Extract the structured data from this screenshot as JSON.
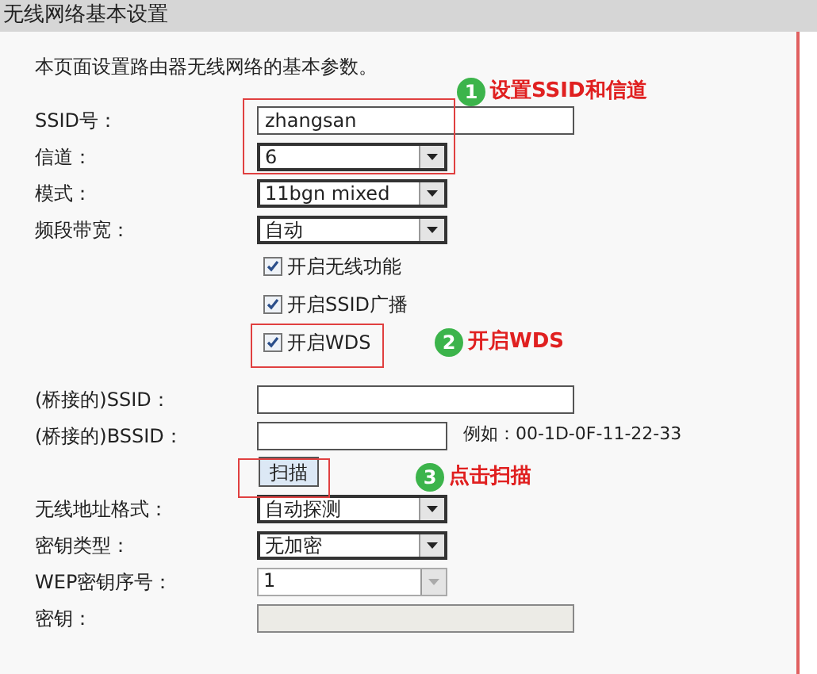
{
  "header": {
    "title": "无线网络基本设置"
  },
  "description": "本页面设置路由器无线网络的基本参数。",
  "groups": [
    {
      "fields": [
        {
          "kind": "text",
          "label": "SSID号：",
          "value": "zhangsan",
          "disabled": false
        },
        {
          "kind": "select",
          "label": "信道：",
          "value": "6",
          "disabled": false
        },
        {
          "kind": "select",
          "label": "模式：",
          "value": "11bgn mixed",
          "disabled": false
        },
        {
          "kind": "select",
          "label": "频段带宽：",
          "value": "自动",
          "disabled": false
        },
        {
          "kind": "checkbox",
          "text": "开启无线功能",
          "checked": true
        },
        {
          "kind": "checkbox",
          "text": "开启SSID广播",
          "checked": true
        },
        {
          "kind": "checkbox",
          "text": "开启WDS",
          "checked": true
        }
      ]
    },
    {
      "fields": [
        {
          "kind": "text",
          "label": "(桥接的)SSID：",
          "disabled": false
        },
        {
          "kind": "mac",
          "label": "(桥接的)BSSID：",
          "example": "例如：00-1D-0F-11-22-33"
        },
        {
          "kind": "button",
          "text": "扫描"
        },
        {
          "kind": "select",
          "label": "无线地址格式：",
          "value": "自动探测",
          "disabled": false
        },
        {
          "kind": "select",
          "label": "密钥类型：",
          "value": "无加密",
          "disabled": false
        },
        {
          "kind": "select",
          "label": "WEP密钥序号：",
          "value": "1",
          "disabled": true
        },
        {
          "kind": "text",
          "label": "密钥：",
          "disabled": true
        }
      ]
    }
  ],
  "annotations": [
    {
      "number": "1",
      "text": "设置SSID和信道"
    },
    {
      "number": "2",
      "text": "开启WDS"
    },
    {
      "number": "3",
      "text": "点击扫描"
    }
  ]
}
